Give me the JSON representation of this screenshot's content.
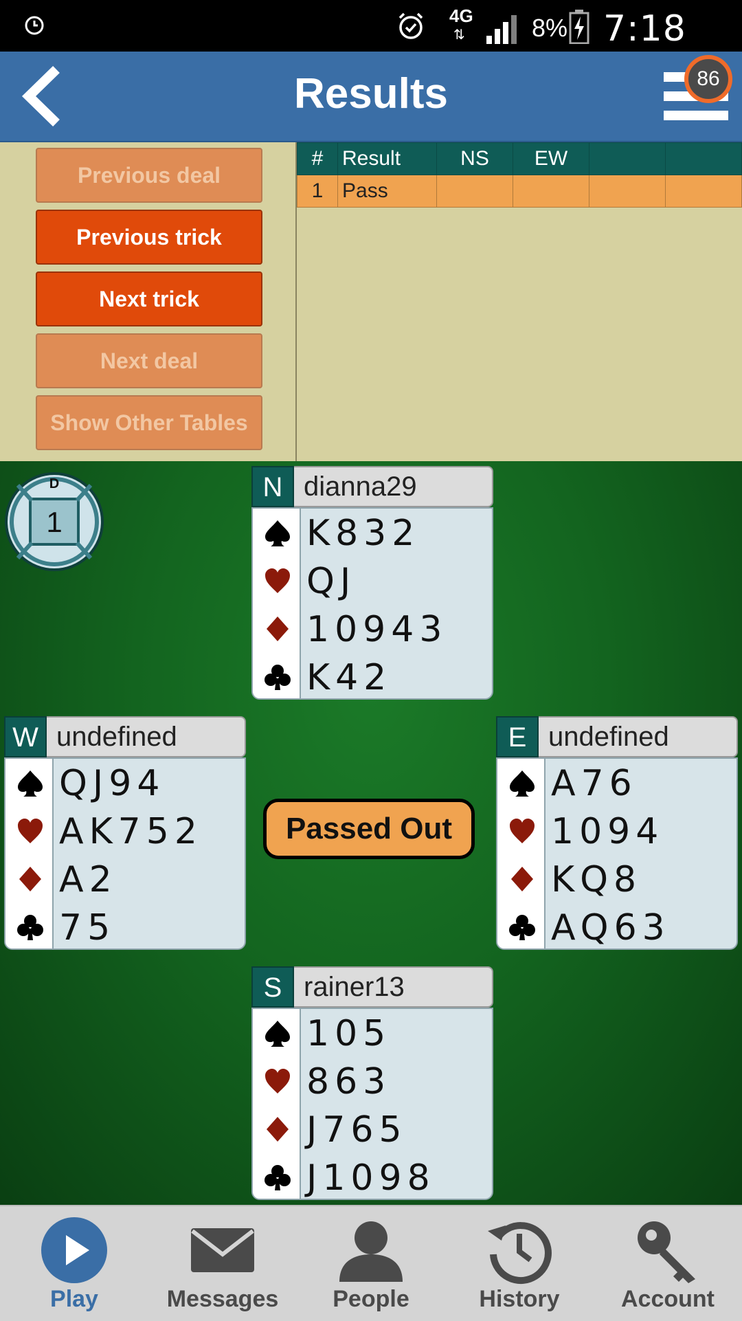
{
  "status_bar": {
    "network": "4G",
    "battery": "8%",
    "time": "7:18 pm"
  },
  "header": {
    "title": "Results",
    "timer": "86"
  },
  "controls": {
    "previous_deal": "Previous deal",
    "previous_trick": "Previous trick",
    "next_trick": "Next trick",
    "next_deal": "Next deal",
    "show_other_tables": "Show Other Tables"
  },
  "results_table": {
    "headers": [
      "#",
      "Result",
      "NS",
      "EW",
      "",
      ""
    ],
    "rows": [
      [
        "1",
        "Pass",
        "",
        "",
        "",
        ""
      ]
    ]
  },
  "board": {
    "dealer_label": "D",
    "board_number": "1",
    "status": "Passed Out",
    "colors": {
      "felt": "#13641f",
      "seat": "#0f5c56",
      "red_suit": "#8b1a0a",
      "black_suit": "#000000"
    }
  },
  "hands": {
    "north": {
      "seat": "N",
      "name": "dianna29",
      "spades": "K832",
      "hearts": "QJ",
      "diamonds": "10943",
      "clubs": "K42"
    },
    "west": {
      "seat": "W",
      "name": "undefined",
      "spades": "QJ94",
      "hearts": "AK752",
      "diamonds": "A2",
      "clubs": "75"
    },
    "east": {
      "seat": "E",
      "name": "undefined",
      "spades": "A76",
      "hearts": "1094",
      "diamonds": "KQ8",
      "clubs": "AQ63"
    },
    "south": {
      "seat": "S",
      "name": "rainer13",
      "spades": "105",
      "hearts": "863",
      "diamonds": "J765",
      "clubs": "J1098"
    }
  },
  "nav": {
    "play": "Play",
    "messages": "Messages",
    "people": "People",
    "history": "History",
    "account": "Account",
    "accent": "#3a6ea6"
  }
}
